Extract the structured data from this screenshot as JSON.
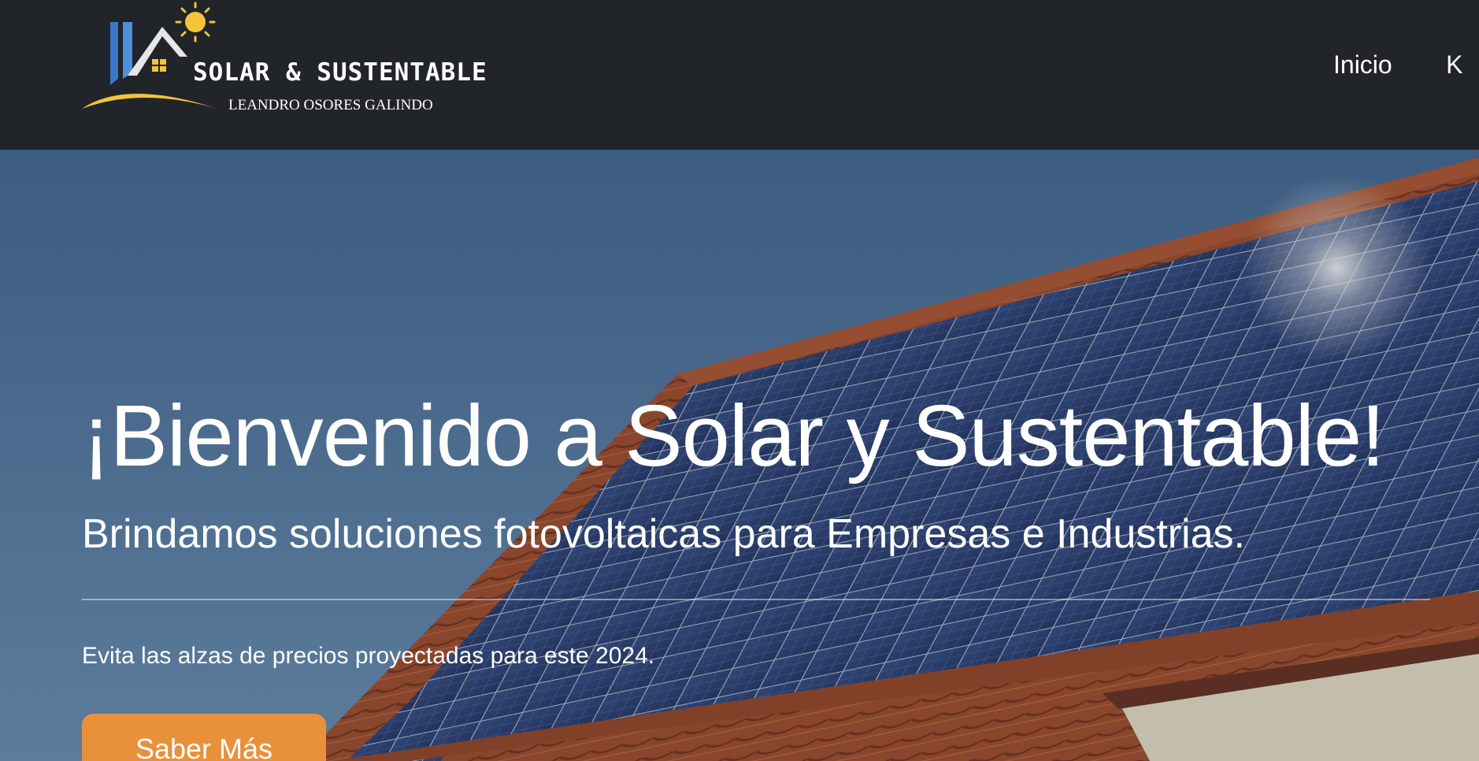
{
  "brand": {
    "name": "SOLAR & SUSTENTABLE",
    "subtitle": "LEANDRO OSORES GALINDO",
    "logo_icon": "house-sun-logo",
    "colors": {
      "sun": "#f2c43a",
      "house_blue": "#3b78c9",
      "roof_white": "#e6e6e6"
    }
  },
  "nav": {
    "links": [
      {
        "label": "Inicio"
      },
      {
        "label": "K"
      }
    ]
  },
  "hero": {
    "title": "¡Bienvenido a Solar y Sustentable!",
    "lead": "Brindamos soluciones fotovoltaicas para Empresas e Industrias.",
    "text": "Evita las alzas de precios proyectadas para este 2024.",
    "cta_label": "Saber Más",
    "background": "solar-panels-on-tiled-roof-photo"
  },
  "colors": {
    "navbar_bg": "#212529",
    "cta_bg": "#e8913a",
    "sky": "#4a6d96",
    "roof_tiles": "#a8502e",
    "panel": "#2c3f73"
  }
}
